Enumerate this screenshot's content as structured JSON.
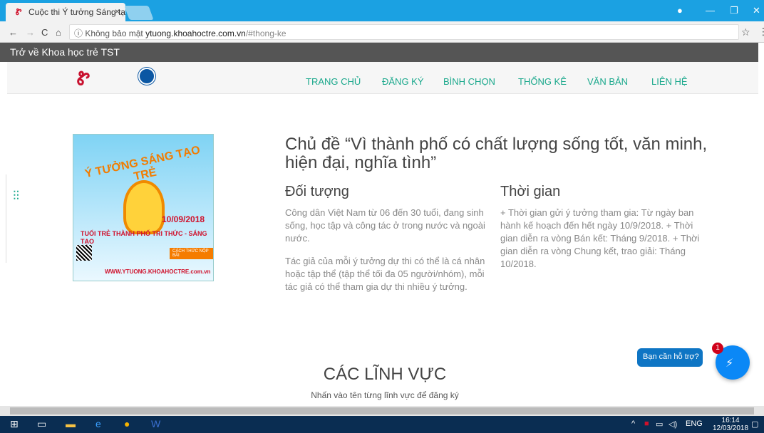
{
  "browser": {
    "tab_title": "Cuộc thi Ý tưởng Sáng tạ",
    "tab_close": "×",
    "address": {
      "security": "ⓘ Không bảo mật",
      "domain": "ytuong.khoahoctre.com.vn",
      "path": "/#thong-ke"
    },
    "window_buttons": [
      "—",
      "❐",
      "✕"
    ]
  },
  "site": {
    "back_link": "Trở về Khoa học trẻ TST",
    "menu": [
      "TRANG CHỦ",
      "ĐĂNG KÝ",
      "BÌNH CHỌN",
      "THỐNG KÊ",
      "VĂN BẢN",
      "LIÊN HỆ"
    ],
    "poster": {
      "headline": "Ý TƯỞNG SÁNG TẠO TRẺ",
      "date": "10/09/2018",
      "slogan": "TUỔI TRẺ THÀNH PHỐ TRI THỨC - SÁNG TẠO",
      "button": "CÁCH THỨC NỘP BÀI",
      "url": "WWW.YTUONG.KHOAHOCTRE.com.vn"
    },
    "topic_title": "Chủ đề “Vì thành phố có chất lượng sống tốt, văn minh, hiện đại, nghĩa tình”",
    "audience": {
      "heading": "Đối tượng",
      "p1": "Công dân Việt Nam từ 06 đến 30 tuổi, đang sinh sống, học tập và công tác ở trong nước và ngoài nước.",
      "p2": "Tác giả của mỗi ý tưởng dự thi có thể là cá nhân hoặc tập thể (tập thể tối đa 05 người/nhóm), mỗi tác giả có thể tham gia dự thi nhiều ý tưởng."
    },
    "time": {
      "heading": "Thời gian",
      "p1": "+ Thời gian gửi ý tưởng tham gia: Từ ngày ban hành kế hoạch đến hết ngày 10/9/2018. + Thời gian diễn ra vòng Bán kết: Tháng 9/2018. + Thời gian diễn ra vòng Chung kết, trao giải: Tháng 10/2018."
    },
    "fields_heading": "CÁC LĨNH VỰC",
    "fields_sub": "Nhấn vào tên từng lĩnh vực để đăng ký",
    "help_label": "Bạn cần hỗ trợ?",
    "messenger_badge": "1"
  },
  "taskbar": {
    "lang": "ENG",
    "time": "16:14",
    "date": "12/03/2018"
  }
}
